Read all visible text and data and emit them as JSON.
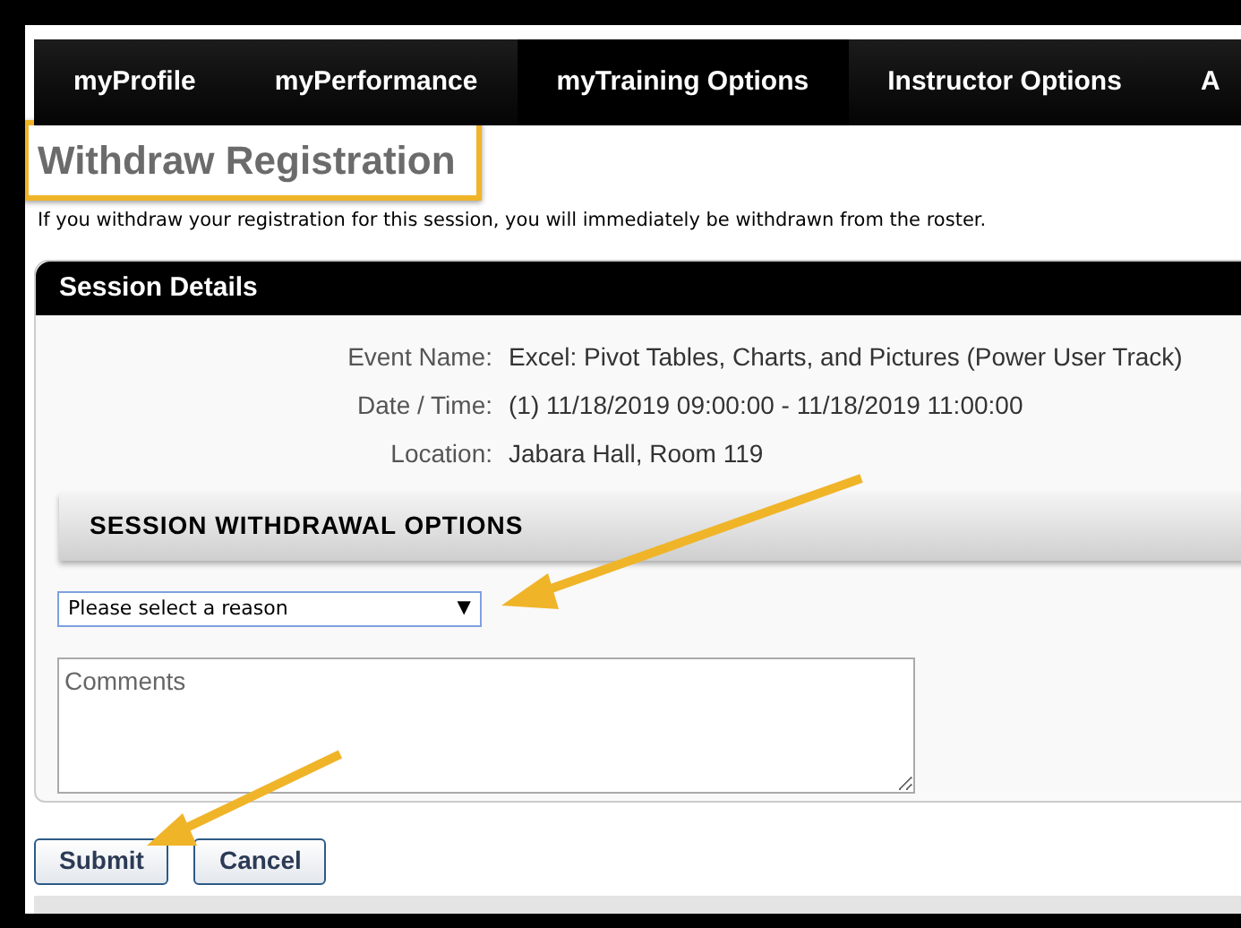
{
  "nav": {
    "tabs": [
      {
        "label": "myProfile",
        "selected": false
      },
      {
        "label": "myPerformance",
        "selected": false
      },
      {
        "label": "myTraining Options",
        "selected": true
      },
      {
        "label": "Instructor Options",
        "selected": false
      },
      {
        "label": "A",
        "selected": false
      }
    ]
  },
  "title": "Withdraw Registration",
  "intro": "If you withdraw your registration for this session, you will immediately be withdrawn from the roster.",
  "session": {
    "header": "Session Details",
    "details": [
      {
        "label": "Event Name:",
        "value": "Excel: Pivot Tables, Charts, and Pictures (Power User Track)"
      },
      {
        "label": "Date / Time:",
        "value": "(1) 11/18/2019 09:00:00 - 11/18/2019 11:00:00"
      },
      {
        "label": "Location:",
        "value": "Jabara Hall, Room 119"
      }
    ],
    "options_header": "SESSION WITHDRAWAL OPTIONS",
    "reason_select": {
      "value": "Please select a reason",
      "arrow": "▼"
    },
    "comments": {
      "placeholder": "Comments"
    }
  },
  "buttons": [
    {
      "label": "Submit"
    },
    {
      "label": "Cancel"
    }
  ]
}
